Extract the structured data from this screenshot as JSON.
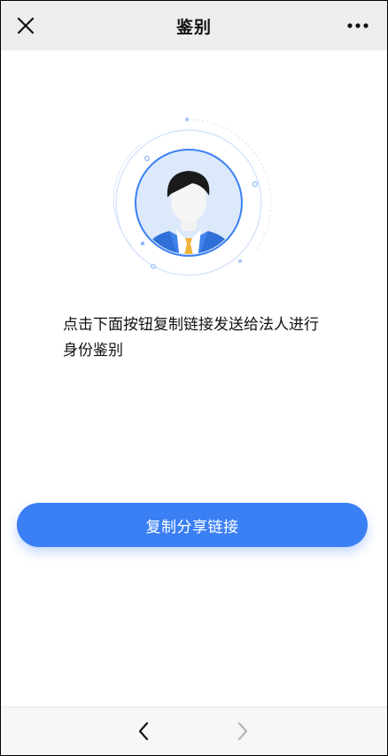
{
  "header": {
    "title": "鉴别",
    "close_icon": "close-icon",
    "more_icon": "more-icon"
  },
  "illustration": {
    "icon": "avatar-icon",
    "accent_color": "#3b7ff5",
    "circle_fill": "#dce9fb"
  },
  "main": {
    "instruction_text": "点击下面按钮复制链接发送给法人进行身份鉴别"
  },
  "actions": {
    "share_button_label": "复制分享链接",
    "share_button_color": "#3b7ff5"
  },
  "footer": {
    "back_icon": "chevron-left-icon",
    "forward_icon": "chevron-right-icon"
  }
}
